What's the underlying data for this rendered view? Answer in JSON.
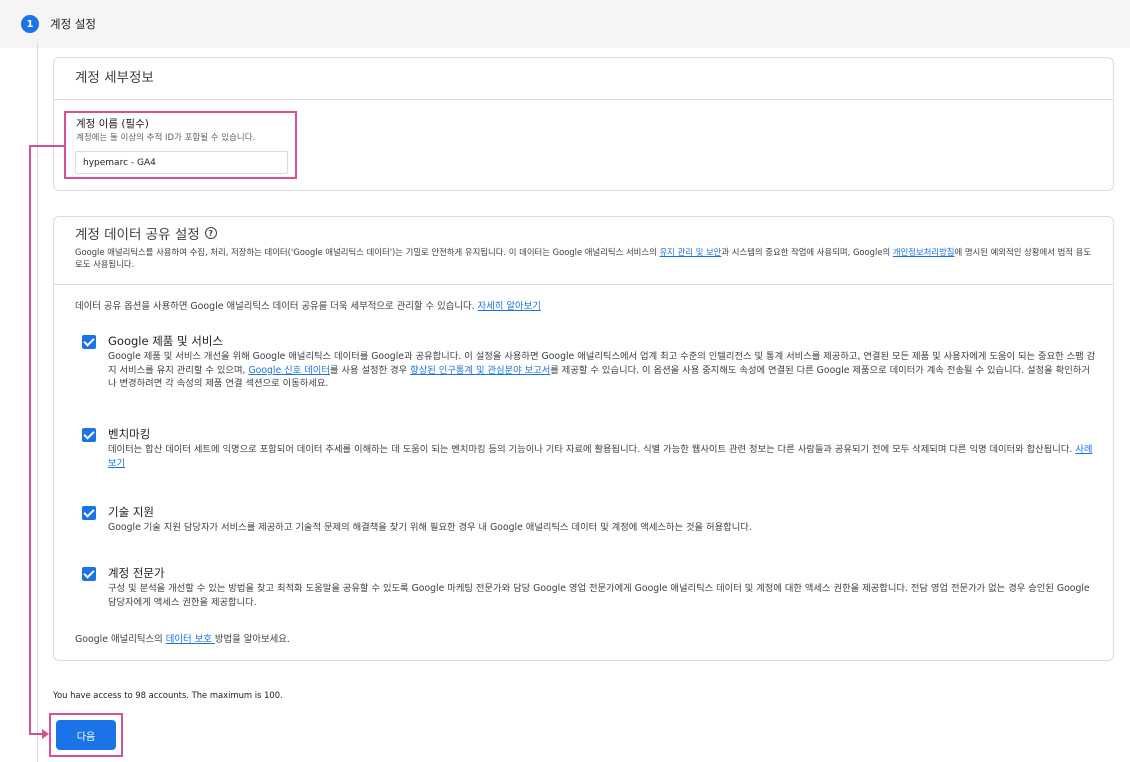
{
  "step": {
    "number": "1",
    "title": "계정 설정"
  },
  "account_details": {
    "title": "계정 세부정보",
    "name_label": "계정 이름 (필수)",
    "name_help": "계정에는 둘 이상의 추적 ID가 포함될 수 있습니다.",
    "name_value": "hypemarc - GA4"
  },
  "data_sharing": {
    "title": "계정 데이터 공유 설정",
    "desc_part1": "Google 애널리틱스를 사용하여 수집, 처리, 저장하는 데이터('Google 애널리틱스 데이터')는 기밀로 안전하게 유지됩니다. 이 데이터는 Google 애널리틱스 서비스의 ",
    "desc_link1": "유지 관리 및 보안",
    "desc_part2": "과 시스템의 중요한 작업에 사용되며, Google의 ",
    "desc_link2": "개인정보처리방침",
    "desc_part3": "에 명시된 예외적인 상황에서 법적 용도로도 사용됩니다.",
    "intro_text": "데이터 공유 옵션을 사용하면 Google 애널리틱스 데이터 공유를 더욱 세부적으로 관리할 수 있습니다. ",
    "intro_link": "자세히 알아보기",
    "options": [
      {
        "title": "Google 제품 및 서비스",
        "desc_part1": "Google 제품 및 서비스 개선을 위해 Google 애널리틱스 데이터를 Google과 공유합니다. 이 설정을 사용하면 Google 애널리틱스에서 업계 최고 수준의 인텔리전스 및 통계 서비스를 제공하고, 연결된 모든 제품 및 사용자에게 도움이 되는 중요한 스팸 감지 서비스를 유지 관리할 수 있으며, ",
        "desc_link1": "Google 신호 데이터",
        "desc_part2": "를 사용 설정한 경우 ",
        "desc_link2": "향상된 인구통계 및 관심분야 보고서",
        "desc_part3": "를 제공할 수 있습니다. 이 옵션을 사용 중지해도 속성에 연결된 다른 Google 제품으로 데이터가 계속 전송될 수 있습니다. 설정을 확인하거나 변경하려면 각 속성의 제품 연결 섹션으로 이동하세요.",
        "checked": true
      },
      {
        "title": "벤치마킹",
        "desc_part1": "데이터는 합산 데이터 세트에 익명으로 포함되어 데이터 추세를 이해하는 데 도움이 되는 벤치마킹 등의 기능이나 기타 자료에 활용됩니다. 식별 가능한 웹사이트 관련 정보는 다른 사람들과 공유되기 전에 모두 삭제되며 다른 익명 데이터와 합산됩니다. ",
        "desc_link1": "사례 보기",
        "checked": true
      },
      {
        "title": "기술 지원",
        "desc_part1": "Google 기술 지원 담당자가 서비스를 제공하고 기술적 문제의 해결책을 찾기 위해 필요한 경우 내 Google 애널리틱스 데이터 및 계정에 액세스하는 것을 허용합니다.",
        "checked": true
      },
      {
        "title": "계정 전문가",
        "desc_part1": "구성 및 분석을 개선할 수 있는 방법을 찾고 최적화 도움말을 공유할 수 있도록 Google 마케팅 전문가와 담당 Google 영업 전문가에게 Google 애널리틱스 데이터 및 계정에 대한 액세스 권한을 제공합니다. 전담 영업 전문가가 없는 경우 승인된 Google 담당자에게 액세스 권한을 제공합니다.",
        "checked": true
      }
    ],
    "footer_part1": "Google 애널리틱스의 ",
    "footer_link": "데이터 보호 ",
    "footer_part2": "방법을 알아보세요."
  },
  "access_note": "You have access to 98 accounts. The maximum is 100.",
  "next_button": "다음",
  "colors": {
    "accent": "#1a73e8",
    "highlight": "#d64f92"
  }
}
